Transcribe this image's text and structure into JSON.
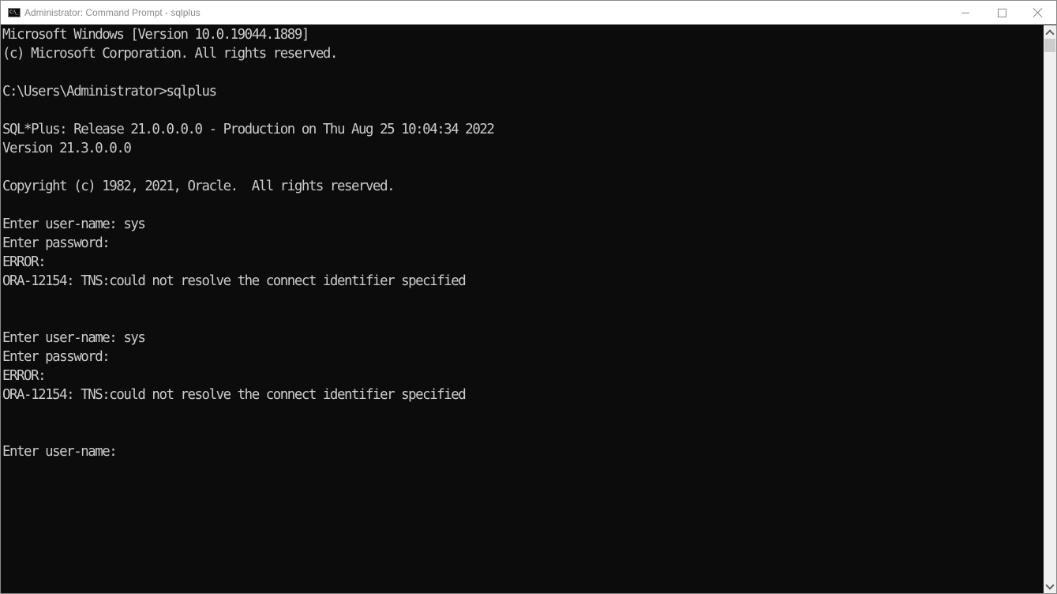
{
  "window": {
    "title": "Administrator: Command Prompt - sqlplus",
    "icon": "cmd-icon",
    "icon_text": "C:\\_",
    "controls": [
      "minimize",
      "maximize",
      "close"
    ]
  },
  "console": {
    "foreground": "#cccccc",
    "background": "#0c0c0c",
    "lines": [
      "Microsoft Windows [Version 10.0.19044.1889]",
      "(c) Microsoft Corporation. All rights reserved.",
      "",
      "C:\\Users\\Administrator>sqlplus",
      "",
      "SQL*Plus: Release 21.0.0.0.0 - Production on Thu Aug 25 10:04:34 2022",
      "Version 21.3.0.0.0",
      "",
      "Copyright (c) 1982, 2021, Oracle.  All rights reserved.",
      "",
      "Enter user-name: sys",
      "Enter password:",
      "ERROR:",
      "ORA-12154: TNS:could not resolve the connect identifier specified",
      "",
      "",
      "Enter user-name: sys",
      "Enter password:",
      "ERROR:",
      "ORA-12154: TNS:could not resolve the connect identifier specified",
      "",
      "",
      "Enter user-name:"
    ]
  },
  "scrollbar": {
    "up_icon": "chevron-up-icon",
    "down_icon": "chevron-down-icon"
  }
}
